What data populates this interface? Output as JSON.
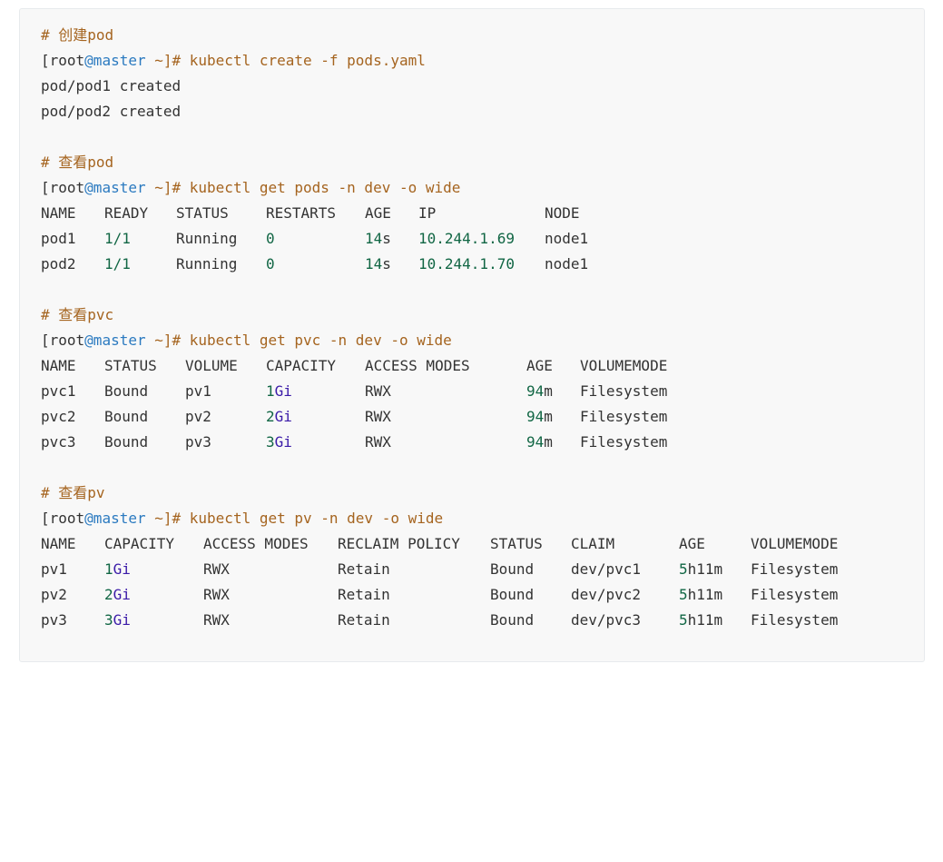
{
  "colors": {
    "background": "#f8f8f8",
    "comment": "#a5641f",
    "keyword_at": "#2b7ac0",
    "number": "#116644",
    "unit": "#3a1aa8",
    "text": "#333333"
  },
  "blocks": {
    "create": {
      "comment": "# 创建pod",
      "prompt": {
        "open": "[root",
        "at": "@master",
        "tilde": " ~]#",
        "command": " kubectl create -f pods.yaml"
      },
      "output": [
        "pod/pod1 created",
        "pod/pod2 created"
      ]
    },
    "pods": {
      "comment": "# 查看pod",
      "prompt": {
        "open": "[root",
        "at": "@master",
        "tilde": " ~]#",
        "command": " kubectl get pods -n dev -o wide"
      },
      "headers": [
        "NAME",
        "READY",
        "STATUS",
        "RESTARTS",
        "AGE",
        "IP",
        "NODE"
      ],
      "rows": [
        {
          "name": "pod1",
          "ready": "1/1",
          "status": "Running",
          "restarts": "0",
          "age_num": "14",
          "age_unit": "s",
          "ip": "10.244.1.69",
          "node": "node1"
        },
        {
          "name": "pod2",
          "ready": "1/1",
          "status": "Running",
          "restarts": "0",
          "age_num": "14",
          "age_unit": "s",
          "ip": "10.244.1.70",
          "node": "node1"
        }
      ]
    },
    "pvc": {
      "comment": "# 查看pvc",
      "prompt": {
        "open": "[root",
        "at": "@master",
        "tilde": " ~]#",
        "command": " kubectl get pvc -n dev -o wide"
      },
      "headers": [
        "NAME",
        "STATUS",
        "VOLUME",
        "CAPACITY",
        "ACCESS MODES",
        "AGE",
        "VOLUMEMODE"
      ],
      "rows": [
        {
          "name": "pvc1",
          "status": "Bound",
          "volume": "pv1",
          "cap_num": "1",
          "cap_unit": "Gi",
          "access": "RWX",
          "age_num": "94",
          "age_unit": "m",
          "mode": "Filesystem"
        },
        {
          "name": "pvc2",
          "status": "Bound",
          "volume": "pv2",
          "cap_num": "2",
          "cap_unit": "Gi",
          "access": "RWX",
          "age_num": "94",
          "age_unit": "m",
          "mode": "Filesystem"
        },
        {
          "name": "pvc3",
          "status": "Bound",
          "volume": "pv3",
          "cap_num": "3",
          "cap_unit": "Gi",
          "access": "RWX",
          "age_num": "94",
          "age_unit": "m",
          "mode": "Filesystem"
        }
      ]
    },
    "pv": {
      "comment": "# 查看pv",
      "prompt": {
        "open": "[root",
        "at": "@master",
        "tilde": " ~]#",
        "command": " kubectl get pv -n dev -o wide"
      },
      "headers": [
        "NAME",
        "CAPACITY",
        "ACCESS MODES",
        "RECLAIM POLICY",
        "STATUS",
        "CLAIM",
        "AGE",
        "VOLUMEMODE"
      ],
      "rows": [
        {
          "name": "pv1",
          "cap_num": "1",
          "cap_unit": "Gi",
          "access": "RWX",
          "reclaim": "Retain",
          "status": "Bound",
          "claim": "dev/pvc1",
          "age_num": "5",
          "age_unit": "h11m",
          "mode": "Filesystem"
        },
        {
          "name": "pv2",
          "cap_num": "2",
          "cap_unit": "Gi",
          "access": "RWX",
          "reclaim": "Retain",
          "status": "Bound",
          "claim": "dev/pvc2",
          "age_num": "5",
          "age_unit": "h11m",
          "mode": "Filesystem"
        },
        {
          "name": "pv3",
          "cap_num": "3",
          "cap_unit": "Gi",
          "access": "RWX",
          "reclaim": "Retain",
          "status": "Bound",
          "claim": "dev/pvc3",
          "age_num": "5",
          "age_unit": "h11m",
          "mode": "Filesystem"
        }
      ]
    }
  }
}
